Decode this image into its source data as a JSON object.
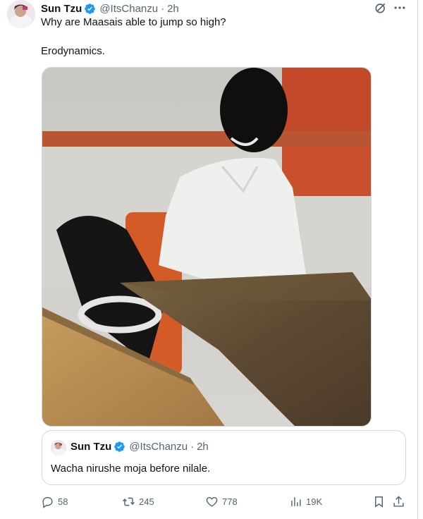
{
  "tweet": {
    "author_name": "Sun Tzu",
    "handle": "@ItsChanzu",
    "separator": "·",
    "time": "2h",
    "text_line1": "Why are Maasais able to jump so high?",
    "text_line2": "Erodynamics."
  },
  "quote": {
    "author_name": "Sun Tzu",
    "handle": "@ItsChanzu",
    "separator": "·",
    "time": "2h",
    "text": "Wacha nirushe moja before nilale."
  },
  "actions": {
    "replies": "58",
    "retweets": "245",
    "likes": "778",
    "views": "19K"
  },
  "colors": {
    "verified": "#1d9bf0",
    "muted": "#536471",
    "border": "#cfd9de"
  },
  "icons": [
    "verified-badge-icon",
    "grok-icon",
    "more-icon",
    "reply-icon",
    "retweet-icon",
    "like-icon",
    "views-icon",
    "bookmark-icon",
    "share-icon"
  ]
}
